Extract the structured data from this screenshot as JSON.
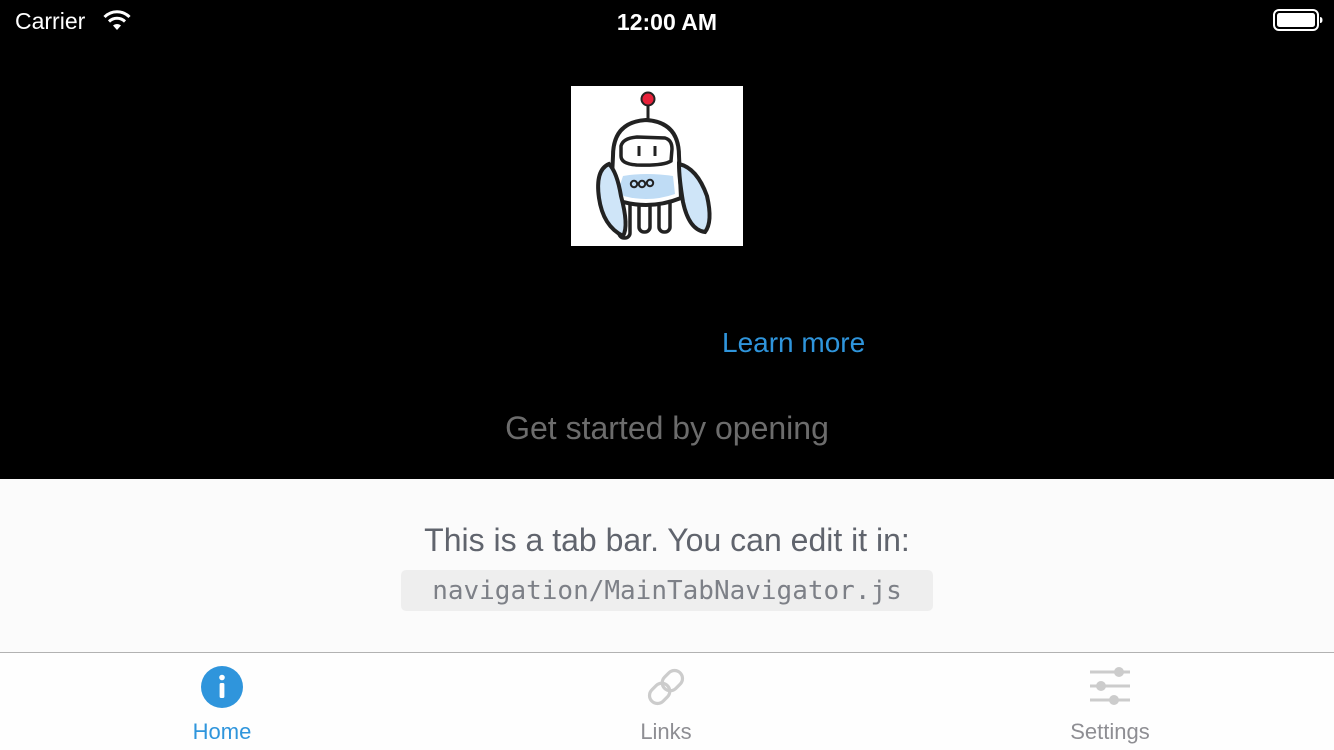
{
  "status_bar": {
    "carrier": "Carrier",
    "time": "12:00 AM",
    "icons": [
      "wifi-icon",
      "battery-icon"
    ]
  },
  "main": {
    "image_icon": "robot-icon",
    "learn_more": "Learn more",
    "get_started": "Get started by opening"
  },
  "info_panel": {
    "text": "This is a tab bar. You can edit it in:",
    "code": "navigation/MainTabNavigator.js"
  },
  "tab_bar": {
    "tabs": [
      {
        "label": "Home",
        "icon": "info-icon",
        "active": true
      },
      {
        "label": "Links",
        "icon": "link-icon",
        "active": false
      },
      {
        "label": "Settings",
        "icon": "settings-sliders-icon",
        "active": false
      }
    ]
  },
  "colors": {
    "accent": "#2f95dc",
    "inactive": "#cccccc",
    "background": "#000000",
    "panel": "#fbfbfb"
  }
}
